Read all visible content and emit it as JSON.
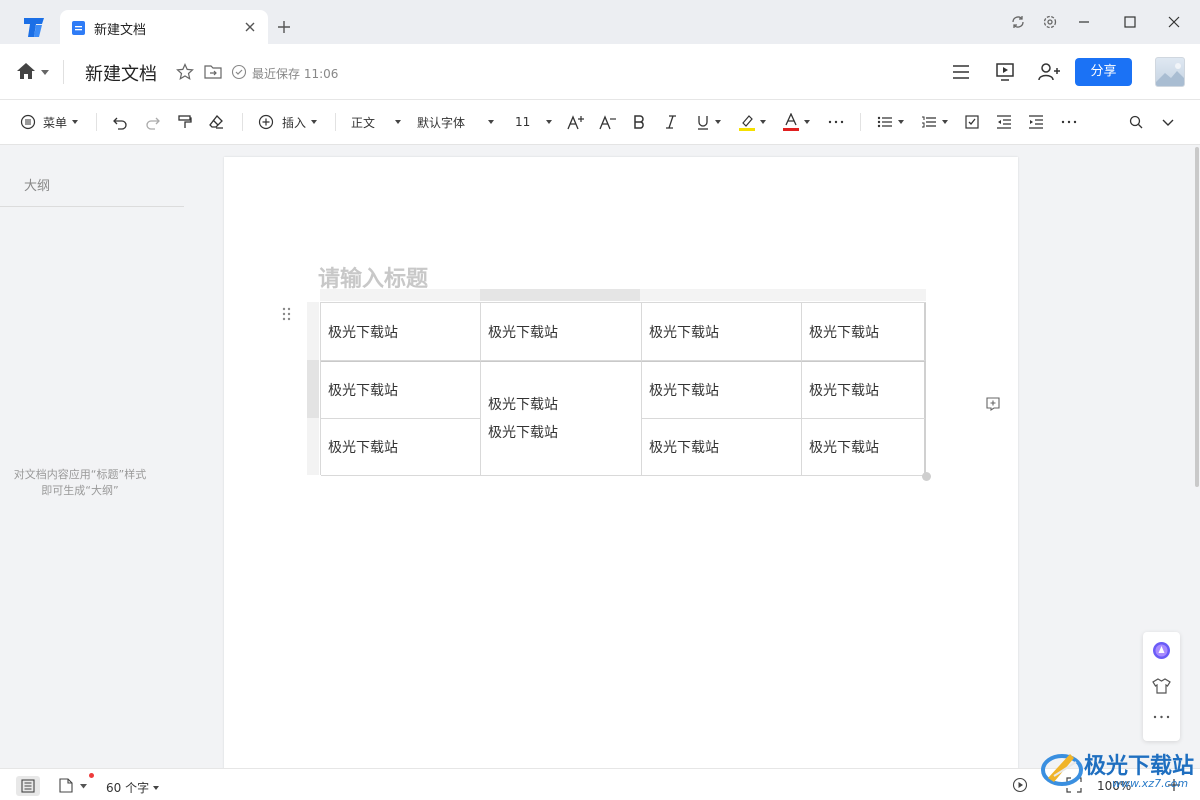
{
  "tabbar": {
    "tab_title": "新建文档"
  },
  "header": {
    "doc_title": "新建文档",
    "saved_text": "最近保存 11:06",
    "share_label": "分享"
  },
  "toolbar": {
    "menu_label": "菜单",
    "insert_label": "插入",
    "style_label": "正文",
    "font_label": "默认字体",
    "size_label": "11",
    "underline_color": "#2b2b2b",
    "highlight_color": "#f5e000",
    "font_color": "#e02020"
  },
  "sidebar": {
    "outline_title": "大纲",
    "hint_line1": "对文档内容应用“标题”样式",
    "hint_line2": "即可生成“大纲”"
  },
  "document": {
    "title_placeholder": "请输入标题",
    "table": {
      "r1": [
        "极光下载站",
        "极光下载站",
        "极光下载站",
        "极光下载站"
      ],
      "r2": [
        "极光下载站",
        "极光下载站",
        "极光下载站"
      ],
      "r3": [
        "极光下载站",
        "极光下载站",
        "极光下载站"
      ],
      "merged_lines": [
        "极光下载站",
        "极光下载站"
      ]
    }
  },
  "statusbar": {
    "word_count": "60 个字",
    "zoom": "100%"
  },
  "watermark": {
    "line1": "极光下载站",
    "line2": "www.xz7.com"
  },
  "colors": {
    "accent": "#1b72f5"
  }
}
